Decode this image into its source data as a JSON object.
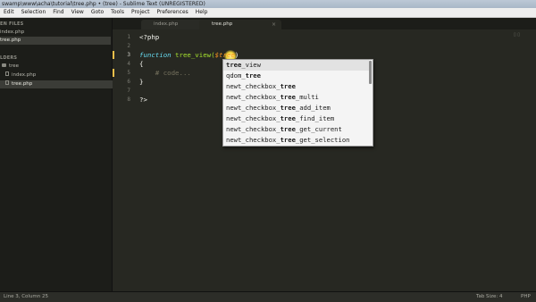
{
  "window": {
    "title": "swamp\\www\\acha\\tutorial\\tree.php • (tree) - Sublime Text (UNREGISTERED)"
  },
  "menu": [
    "Edit",
    "Selection",
    "Find",
    "View",
    "Goto",
    "Tools",
    "Project",
    "Preferences",
    "Help"
  ],
  "sidebar": {
    "open_files_heading": "EN FILES",
    "open_files": [
      {
        "label": "index.php",
        "active": false
      },
      {
        "label": "tree.php",
        "active": true
      }
    ],
    "folders_heading": "LDERS",
    "folder": {
      "label": "tree"
    },
    "folder_files": [
      {
        "label": "index.php",
        "active": false
      },
      {
        "label": "tree.php",
        "active": true
      }
    ]
  },
  "tabs": [
    {
      "label": "index.php",
      "close": "×",
      "active": false
    },
    {
      "label": "tree.php",
      "close": "×",
      "active": true
    }
  ],
  "editor": {
    "line_numbers": [
      "1",
      "2",
      "3",
      "4",
      "5",
      "6",
      "7",
      "8"
    ],
    "current_line": 3,
    "lines": {
      "l1": "<?php",
      "l3_kw": "function",
      "l3_name": " tree_view(",
      "l3_var": "$tree",
      "l3_close": ")",
      "l4": "{",
      "l5": "    # code...",
      "l6": "}",
      "l8": "?>"
    },
    "fold_icons": "▯ ▯"
  },
  "autocomplete": {
    "items": [
      {
        "pre": "",
        "match": "tree",
        "post": "_view",
        "selected": true
      },
      {
        "pre": "qdom_",
        "match": "tree",
        "post": "",
        "selected": false
      },
      {
        "pre": "newt_checkbox_",
        "match": "tree",
        "post": "",
        "selected": false
      },
      {
        "pre": "newt_checkbox_",
        "match": "tree",
        "post": "_multi",
        "selected": false
      },
      {
        "pre": "newt_checkbox_",
        "match": "tree",
        "post": "_add_item",
        "selected": false
      },
      {
        "pre": "newt_checkbox_",
        "match": "tree",
        "post": "_find_item",
        "selected": false
      },
      {
        "pre": "newt_checkbox_",
        "match": "tree",
        "post": "_get_current",
        "selected": false
      },
      {
        "pre": "newt_checkbox_",
        "match": "tree",
        "post": "_get_selection",
        "selected": false
      }
    ]
  },
  "status": {
    "position": "Line 3, Column 25",
    "tab_size": "Tab Size: 4",
    "syntax": "PHP"
  },
  "colors": {
    "editor_bg": "#272822",
    "sidebar_bg": "#1c1d19",
    "keyword": "#66d9ef",
    "function_name": "#a6e22e",
    "variable": "#fd971f",
    "comment": "#75715e",
    "modified_marker": "#f5c04b"
  }
}
